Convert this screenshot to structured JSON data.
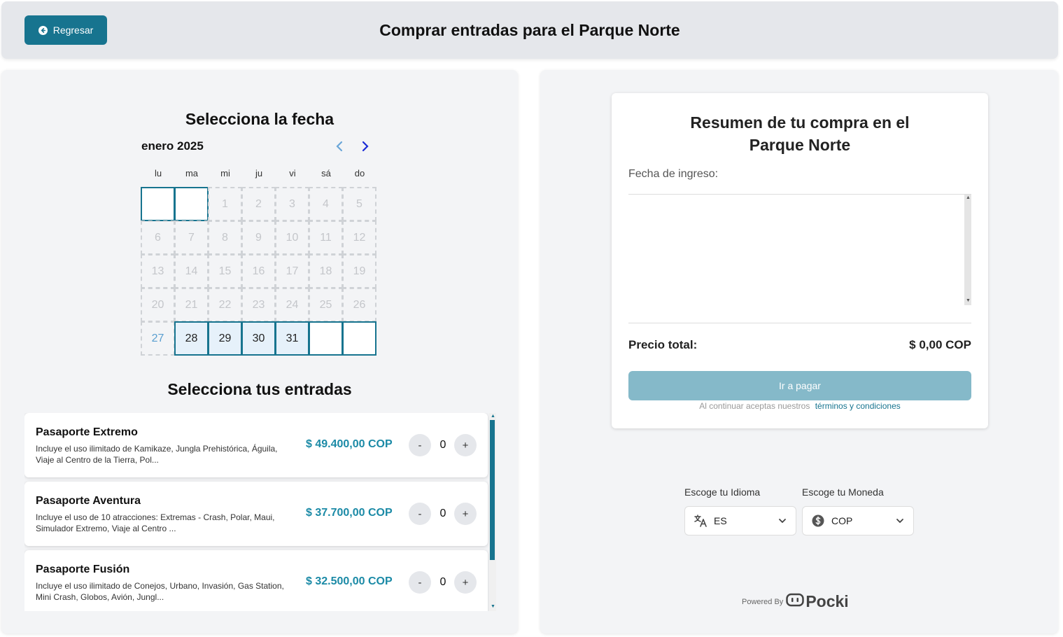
{
  "header": {
    "back_label": "Regresar",
    "title": "Comprar entradas para el Parque Norte"
  },
  "calendar": {
    "section_title": "Selecciona la fecha",
    "month": "enero 2025",
    "weekdays": [
      "lu",
      "ma",
      "mi",
      "ju",
      "vi",
      "sá",
      "do"
    ],
    "days": [
      {
        "label": "",
        "state": "outline"
      },
      {
        "label": "",
        "state": "outline"
      },
      {
        "label": "1",
        "state": "disabled"
      },
      {
        "label": "2",
        "state": "disabled"
      },
      {
        "label": "3",
        "state": "disabled"
      },
      {
        "label": "4",
        "state": "disabled"
      },
      {
        "label": "5",
        "state": "disabled"
      },
      {
        "label": "6",
        "state": "disabled"
      },
      {
        "label": "7",
        "state": "disabled"
      },
      {
        "label": "8",
        "state": "disabled"
      },
      {
        "label": "9",
        "state": "disabled"
      },
      {
        "label": "10",
        "state": "disabled"
      },
      {
        "label": "11",
        "state": "disabled"
      },
      {
        "label": "12",
        "state": "disabled"
      },
      {
        "label": "13",
        "state": "disabled"
      },
      {
        "label": "14",
        "state": "disabled"
      },
      {
        "label": "15",
        "state": "disabled"
      },
      {
        "label": "16",
        "state": "disabled"
      },
      {
        "label": "17",
        "state": "disabled"
      },
      {
        "label": "18",
        "state": "disabled"
      },
      {
        "label": "19",
        "state": "disabled"
      },
      {
        "label": "20",
        "state": "disabled"
      },
      {
        "label": "21",
        "state": "disabled"
      },
      {
        "label": "22",
        "state": "disabled"
      },
      {
        "label": "23",
        "state": "disabled"
      },
      {
        "label": "24",
        "state": "disabled"
      },
      {
        "label": "25",
        "state": "disabled"
      },
      {
        "label": "26",
        "state": "disabled"
      },
      {
        "label": "27",
        "state": "today"
      },
      {
        "label": "28",
        "state": "available"
      },
      {
        "label": "29",
        "state": "available"
      },
      {
        "label": "30",
        "state": "available"
      },
      {
        "label": "31",
        "state": "available"
      },
      {
        "label": "",
        "state": "outline"
      },
      {
        "label": "",
        "state": "outline"
      }
    ]
  },
  "tickets": {
    "section_title": "Selecciona tus entradas",
    "items": [
      {
        "name": "Pasaporte Extremo",
        "description": "Incluye el uso ilimitado de Kamikaze, Jungla Prehistórica, Águila, Viaje al Centro de la Tierra, Pol...",
        "price": "$ 49.400,00 COP",
        "quantity": "0",
        "minus": "-",
        "plus": "+"
      },
      {
        "name": "Pasaporte Aventura",
        "description": "Incluye el uso de 10 atracciones: Extremas - Crash, Polar, Maui, Simulador Extremo, Viaje al Centro ...",
        "price": "$ 37.700,00 COP",
        "quantity": "0",
        "minus": "-",
        "plus": "+"
      },
      {
        "name": "Pasaporte Fusión",
        "description": "Incluye el uso ilimitado de Conejos, Urbano, Invasión, Gas Station, Mini Crash, Globos, Avión, Jungl...",
        "price": "$ 32.500,00 COP",
        "quantity": "0",
        "minus": "-",
        "plus": "+"
      }
    ]
  },
  "summary": {
    "title_line1": "Resumen de tu compra en el",
    "title_line2": "Parque Norte",
    "date_label": "Fecha de ingreso:",
    "total_label": "Precio total:",
    "total_value": "$ 0,00 COP",
    "pay_label": "Ir a pagar",
    "terms_text": "Al continuar aceptas nuestros",
    "terms_link": "términos y condiciones"
  },
  "settings": {
    "language_label": "Escoge tu Idioma",
    "language_value": "ES",
    "currency_label": "Escoge tu Moneda",
    "currency_value": "COP"
  },
  "footer": {
    "powered_by": "Powered By",
    "brand": "Pocki"
  },
  "colors": {
    "accent": "#17748f",
    "price": "#1b8aa6",
    "pay_disabled": "#85b9c9",
    "available_day": "#e6f1fa"
  }
}
